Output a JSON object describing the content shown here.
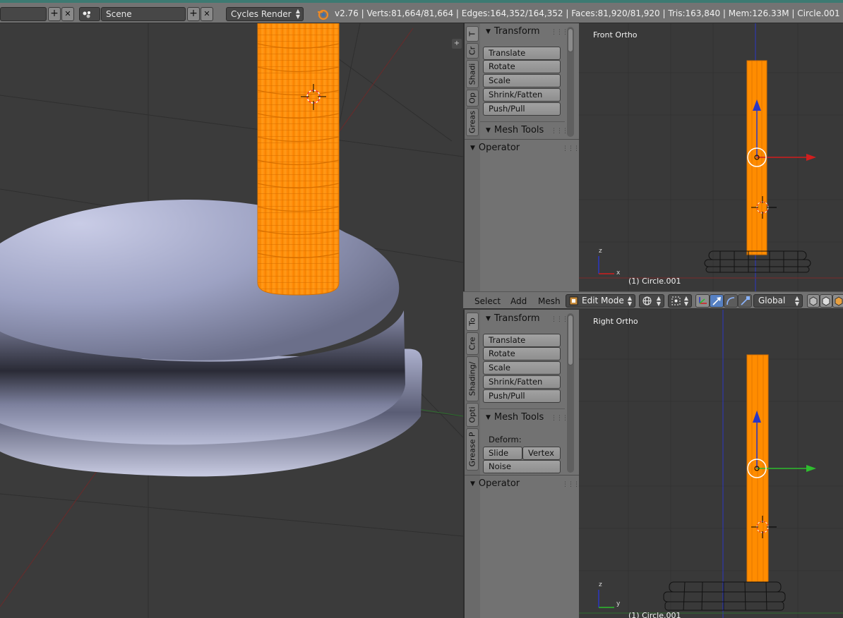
{
  "topbar": {
    "scene_name": "Scene",
    "render_engine": "Cycles Render",
    "stats": "v2.76 | Verts:81,664/81,664 | Edges:164,352/164,352 | Faces:81,920/81,920 | Tris:163,840 | Mem:126.33M | Circle.001",
    "add_icon": "+",
    "close_icon": "✕"
  },
  "shelf_top": {
    "tabs": [
      "T",
      "Cr",
      "Shadi",
      "Op",
      "Greas"
    ],
    "transform_title": "Transform",
    "buttons": [
      "Translate",
      "Rotate",
      "Scale",
      "Shrink/Fatten",
      "Push/Pull"
    ],
    "mesh_tools_title": "Mesh Tools",
    "operator_title": "Operator"
  },
  "shelf_bottom": {
    "tabs": [
      "To",
      "Cre",
      "Shading/",
      "Opti",
      "Grease P"
    ],
    "transform_title": "Transform",
    "buttons": [
      "Translate",
      "Rotate",
      "Scale",
      "Shrink/Fatten",
      "Push/Pull"
    ],
    "mesh_tools_title": "Mesh Tools",
    "deform_label": "Deform:",
    "slide_edge": "Slide Edg",
    "vertex": "Vertex",
    "noise": "Noise",
    "operator_title": "Operator"
  },
  "front_view": {
    "label": "Front Ortho",
    "object": "(1) Circle.001",
    "axis_z": "z",
    "axis_x": "x"
  },
  "right_view": {
    "label": "Right Ortho",
    "object": "(1) Circle.001",
    "axis_z": "z",
    "axis_y": "y"
  },
  "view_header": {
    "menus": [
      "Select",
      "Add",
      "Mesh"
    ],
    "mode": "Edit Mode",
    "orientation": "Global"
  },
  "colors": {
    "selection_orange": "#ff8c00",
    "mesh_blue": "#9aa0c8",
    "x_axis": "#d21e1e",
    "y_axis": "#2ebd2e",
    "z_axis": "#2b37c4"
  }
}
